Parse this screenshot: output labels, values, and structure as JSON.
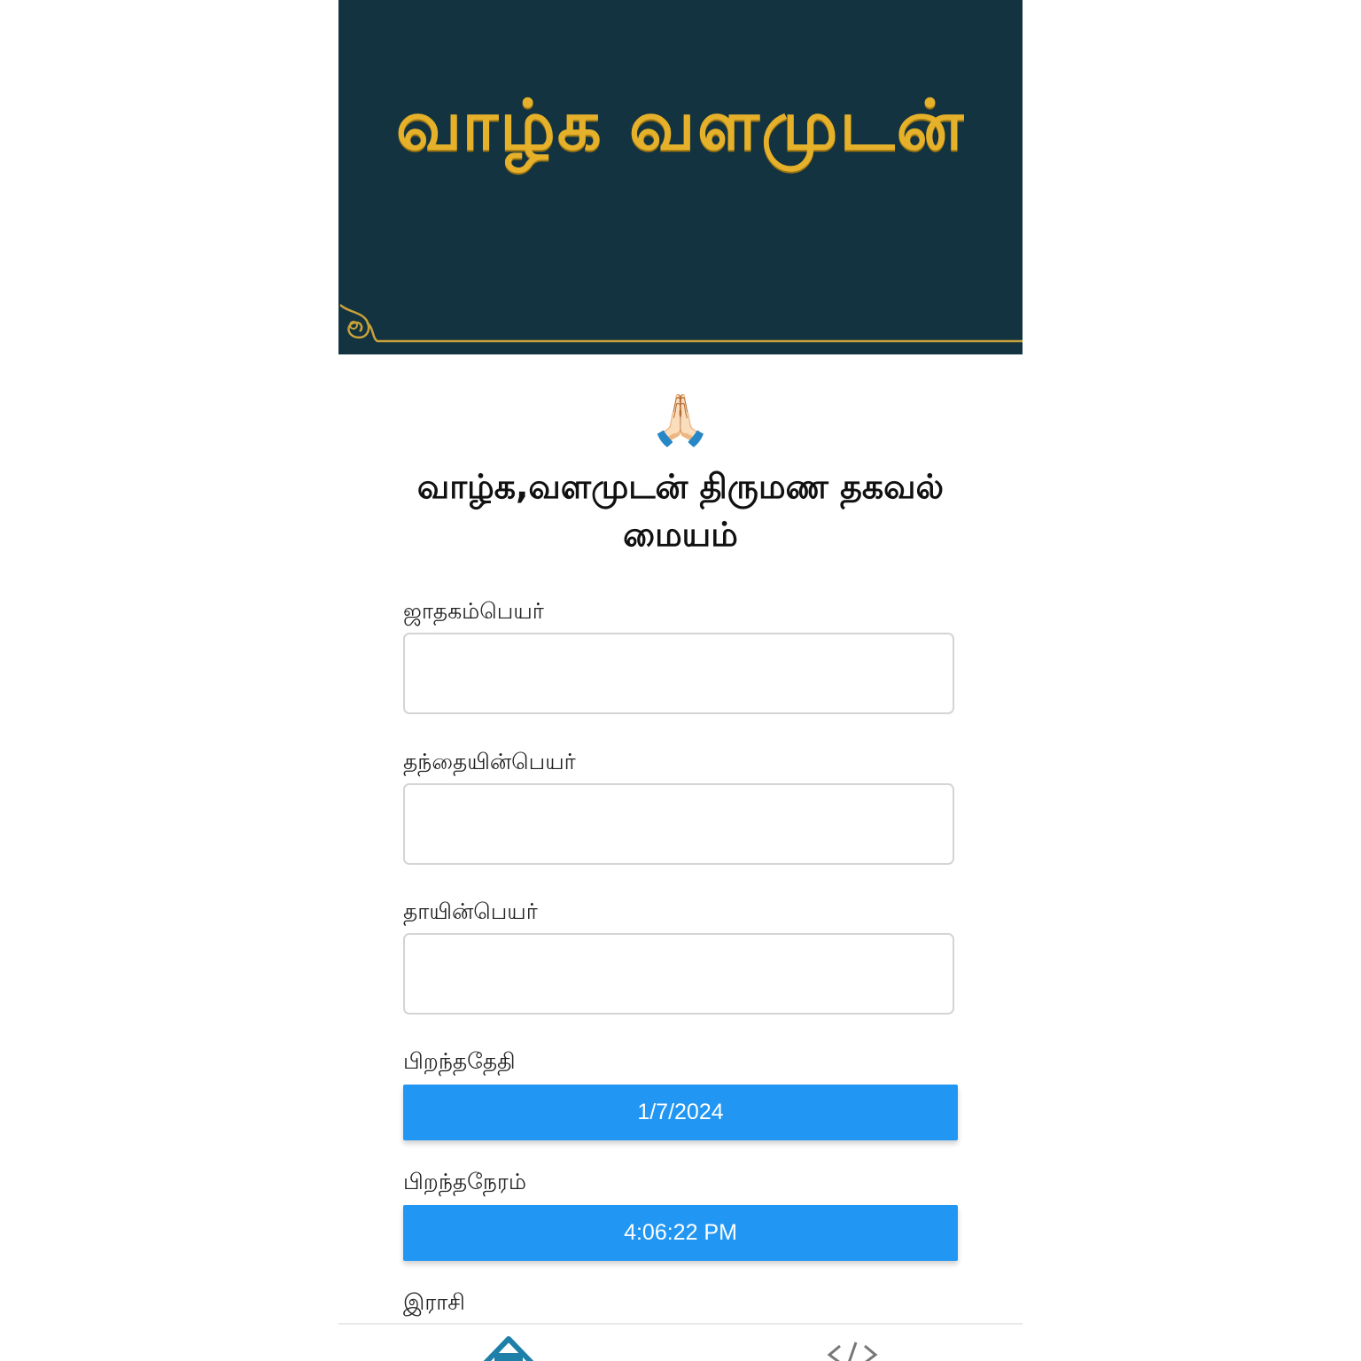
{
  "banner": {
    "title": "வாழ்க வளமுடன்",
    "background_color": "#12333f",
    "title_color": "#e6b12a"
  },
  "greeting_icon": "🙏🏻",
  "heading": "வாழ்க,வளமுடன் திருமண தகவல் மையம்",
  "form": {
    "horoscope_name": {
      "label": "ஜாதகம்பெயர்",
      "value": ""
    },
    "father_name": {
      "label": "தந்தையின்பெயர்",
      "value": ""
    },
    "mother_name": {
      "label": "தாயின்பெயர்",
      "value": ""
    },
    "birth_date": {
      "label": "பிறந்ததேதி",
      "value": "1/7/2024"
    },
    "birth_time": {
      "label": "பிறந்தநேரம்",
      "value": "4:06:22 PM"
    },
    "rasi": {
      "label": "இராசி"
    }
  },
  "accent_color": "#2196f3",
  "bottom_nav": {
    "items": [
      {
        "icon": "home-icon",
        "color": "#1e7fa8"
      },
      {
        "icon": "code-icon",
        "color": "#777777"
      }
    ]
  }
}
